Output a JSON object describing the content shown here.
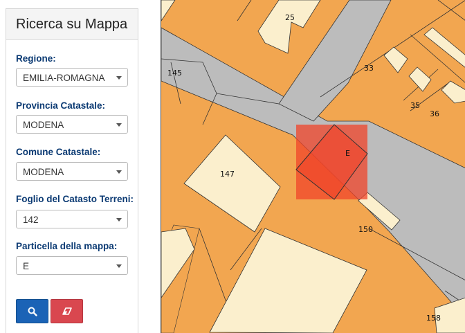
{
  "panel": {
    "title": "Ricerca su Mappa",
    "fields": [
      {
        "label": "Regione:",
        "value": "EMILIA-ROMAGNA"
      },
      {
        "label": "Provincia Catastale:",
        "value": "MODENA"
      },
      {
        "label": "Comune Catastale:",
        "value": "MODENA"
      },
      {
        "label": "Foglio del Catasto Terreni:",
        "value": "142"
      },
      {
        "label": "Particella della mappa:",
        "value": "E"
      }
    ],
    "search_icon": "search-icon",
    "clear_icon": "eraser-icon"
  },
  "map": {
    "parcels": {
      "p25": "25",
      "p33": "33",
      "p35": "35",
      "p36": "36",
      "p145": "145",
      "p147": "147",
      "pE": "E",
      "p150": "150",
      "p158": "158"
    },
    "colors": {
      "land": "#f2a650",
      "road": "#bcbcbc",
      "building": "#fbefcd",
      "highlight": "#f0442a"
    }
  }
}
